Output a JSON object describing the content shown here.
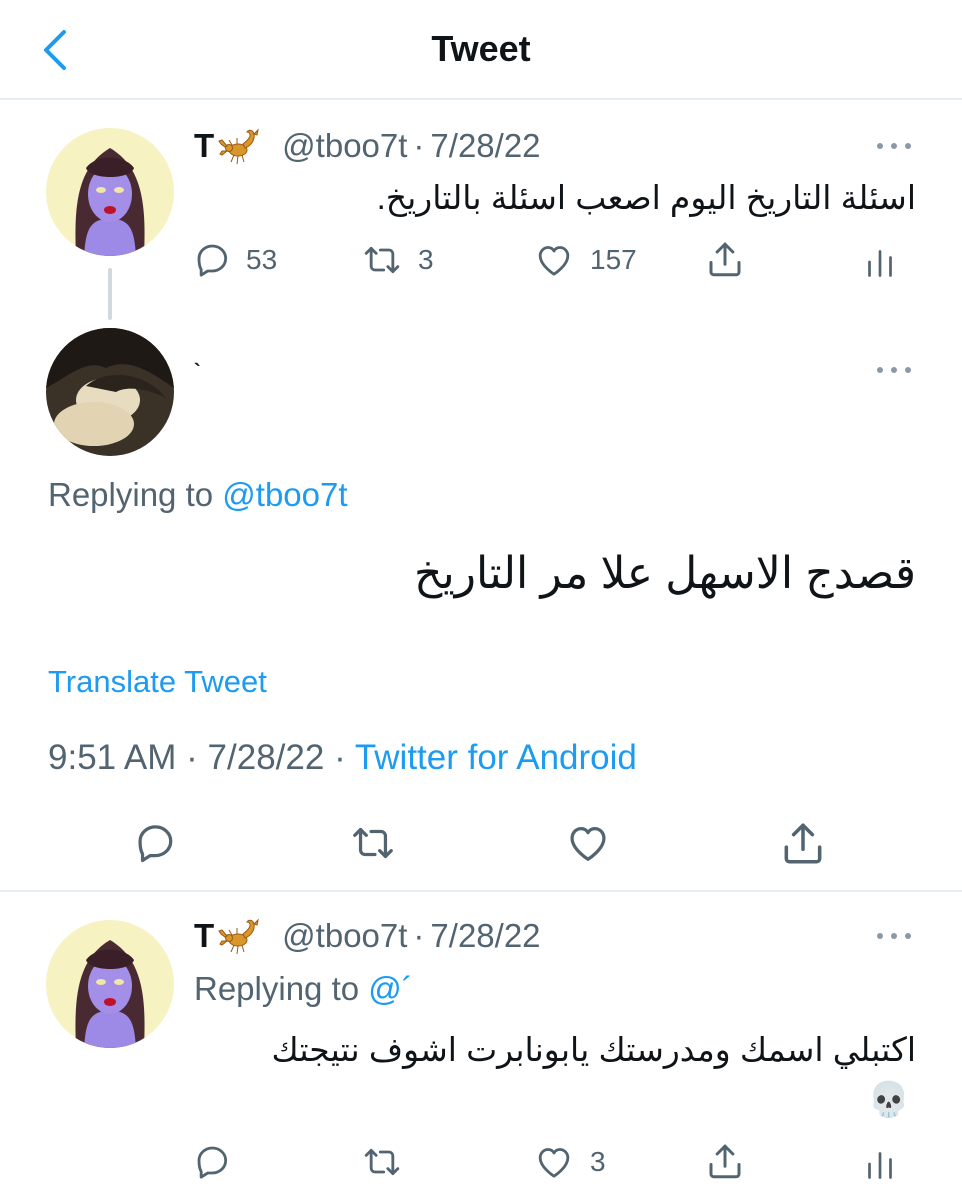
{
  "header": {
    "title": "Tweet",
    "back_icon": "chevron-left-icon"
  },
  "colors": {
    "accent": "#1d9bf0",
    "secondary_text": "#536471",
    "divider": "#e6ecf0"
  },
  "tweet1": {
    "name": "T",
    "name_emoji": "scorpion-emoji",
    "handle": "@tboo7t",
    "separator": "·",
    "date": "7/28/22",
    "text": "اسئلة التاريخ اليوم اصعب اسئلة بالتاريخ.",
    "replies": "53",
    "retweets": "3",
    "likes": "157"
  },
  "main_tweet": {
    "name": "`",
    "replying_label": "Replying to",
    "replying_handle": "@tboo7t",
    "text": "قصدج الاسهل علا مر التاريخ",
    "translate": "Translate Tweet",
    "time": "9:51 AM",
    "separator": "·",
    "date": "7/28/22",
    "source": "Twitter for Android"
  },
  "tweet3": {
    "name": "T",
    "name_emoji": "scorpion-emoji",
    "handle": "@tboo7t",
    "separator": "·",
    "date": "7/28/22",
    "replying_label": "Replying to",
    "replying_handle": "@´",
    "text": "اكتبلي اسمك ومدرستك يابونابرت اشوف نتيجتك",
    "emoji": "💀",
    "likes": "3"
  }
}
